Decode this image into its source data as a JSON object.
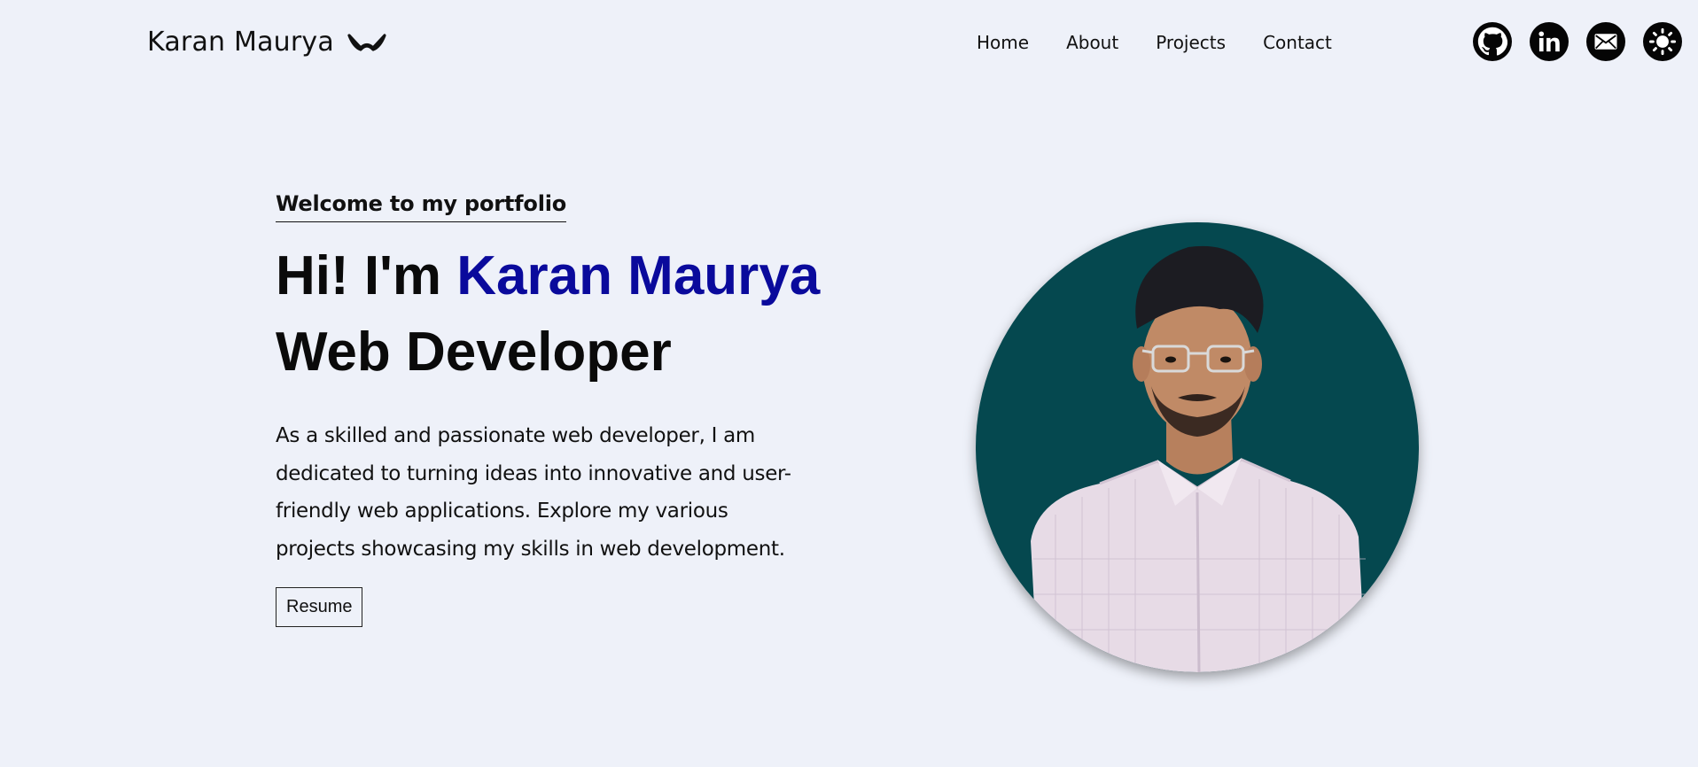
{
  "brand": {
    "name": "Karan Maurya",
    "logo_icon": "bowtie-logo-icon"
  },
  "nav": {
    "items": [
      {
        "label": "Home"
      },
      {
        "label": "About"
      },
      {
        "label": "Projects"
      },
      {
        "label": "Contact"
      }
    ]
  },
  "social": [
    {
      "icon": "github-icon"
    },
    {
      "icon": "linkedin-icon"
    },
    {
      "icon": "mail-icon"
    },
    {
      "icon": "theme-toggle-icon"
    }
  ],
  "hero": {
    "welcome": "Welcome to my portfolio",
    "greeting": "Hi! I'm",
    "name": "Karan Maurya",
    "role": "Web Developer",
    "intro": "As a skilled and passionate web developer, I am dedicated to turning ideas into innovative and user-friendly web applications. Explore my various projects showcasing my skills in web development.",
    "resume_label": "Resume"
  },
  "colors": {
    "background": "#eef1f9",
    "accent": "#0a0a9c",
    "portrait_bg": "#05484f"
  }
}
